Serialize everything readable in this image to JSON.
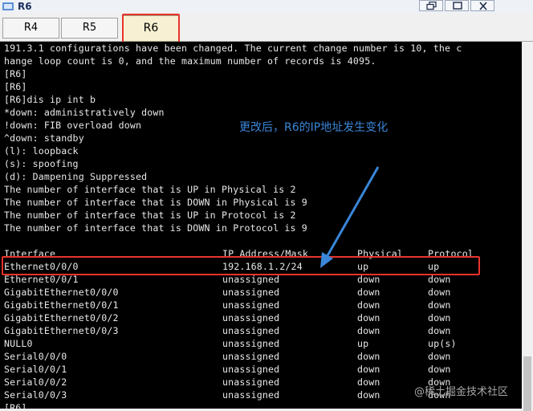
{
  "window": {
    "title": "R6"
  },
  "tabs": [
    {
      "label": "R4"
    },
    {
      "label": "R5"
    },
    {
      "label": "R6",
      "active": true
    }
  ],
  "terminal": {
    "lines": [
      "191.3.1 configurations have been changed. The current change number is 10, the c",
      "hange loop count is 0, and the maximum number of records is 4095.",
      "[R6]",
      "[R6]",
      "[R6]dis ip int b",
      "*down: administratively down",
      "!down: FIB overload down",
      "^down: standby",
      "(l): loopback",
      "(s): spoofing",
      "(d): Dampening Suppressed",
      "The number of interface that is UP in Physical is 2",
      "The number of interface that is DOWN in Physical is 9",
      "The number of interface that is UP in Protocol is 2",
      "The number of interface that is DOWN in Protocol is 9"
    ],
    "table_header": {
      "interface": "Interface",
      "ip": "IP Address/Mask",
      "physical": "Physical",
      "protocol": "Protocol"
    },
    "rows": [
      {
        "interface": "Ethernet0/0/0",
        "ip": "192.168.1.2/24",
        "physical": "up",
        "protocol": "up"
      },
      {
        "interface": "Ethernet0/0/1",
        "ip": "unassigned",
        "physical": "down",
        "protocol": "down"
      },
      {
        "interface": "GigabitEthernet0/0/0",
        "ip": "unassigned",
        "physical": "down",
        "protocol": "down"
      },
      {
        "interface": "GigabitEthernet0/0/1",
        "ip": "unassigned",
        "physical": "down",
        "protocol": "down"
      },
      {
        "interface": "GigabitEthernet0/0/2",
        "ip": "unassigned",
        "physical": "down",
        "protocol": "down"
      },
      {
        "interface": "GigabitEthernet0/0/3",
        "ip": "unassigned",
        "physical": "down",
        "protocol": "down"
      },
      {
        "interface": "NULL0",
        "ip": "unassigned",
        "physical": "up",
        "protocol": "up(s)"
      },
      {
        "interface": "Serial0/0/0",
        "ip": "unassigned",
        "physical": "down",
        "protocol": "down"
      },
      {
        "interface": "Serial0/0/1",
        "ip": "unassigned",
        "physical": "down",
        "protocol": "down"
      },
      {
        "interface": "Serial0/0/2",
        "ip": "unassigned",
        "physical": "down",
        "protocol": "down"
      },
      {
        "interface": "Serial0/0/3",
        "ip": "unassigned",
        "physical": "down",
        "protocol": "down"
      }
    ],
    "prompt": "[R6]"
  },
  "annotation": {
    "text": "更改后，R6的IP地址发生变化"
  },
  "watermark": {
    "text": "@稀土掘金技术社区"
  },
  "colors": {
    "terminal_bg": "#000000",
    "terminal_fg": "#e8e8e8",
    "highlight_red": "#e8332b",
    "annotation_blue": "#3a86d8"
  }
}
